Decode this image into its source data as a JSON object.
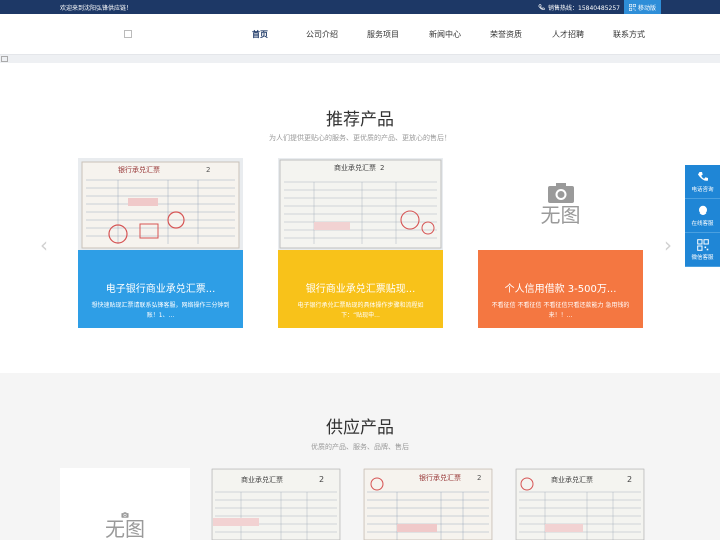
{
  "topbar": {
    "welcome": "欢迎来到沈阳弘锋供应链！",
    "hotline_label": "销售热线：15840485257",
    "mobile_label": "移动版"
  },
  "nav": {
    "items": [
      {
        "label": "首页",
        "active": true
      },
      {
        "label": "公司介绍"
      },
      {
        "label": "服务项目"
      },
      {
        "label": "新闻中心"
      },
      {
        "label": "荣誉资质"
      },
      {
        "label": "人才招聘"
      },
      {
        "label": "联系方式"
      }
    ]
  },
  "recommended": {
    "title": "推荐产品",
    "subtitle": "为人们提供更贴心的服务、更优质的产品、更放心的售后！",
    "cards": [
      {
        "title": "电子银行商业承兑汇票...",
        "desc": "想快速贴现汇票请联系弘锋客服，网络操作三分钟到账！1、...",
        "cheque_header": "银行承兑汇票",
        "cheque_no": "2"
      },
      {
        "title": "银行商业承兑汇票贴现...",
        "desc": "电子银行承兑汇票贴现的具体操作步骤和流程如下：“贴现申...",
        "cheque_header": "商业承兑汇票",
        "cheque_no": "2"
      },
      {
        "title": "个人信用借款 3-500万...",
        "desc": "不看征信 不看征信 不看征信只看还款能力 急用钱的来！！...",
        "noimg_text": "无图"
      }
    ]
  },
  "supply": {
    "title": "供应产品",
    "subtitle": "优质的产品、服务、品牌、售后",
    "cards": [
      {
        "noimg_text": "无图"
      },
      {
        "cheque_header": "商业承兑汇票",
        "cheque_no": "2"
      },
      {
        "cheque_header": "银行承兑汇票",
        "cheque_no": "2"
      },
      {
        "cheque_header": "商业承兑汇票",
        "cheque_no": "2"
      }
    ]
  },
  "sidebar": {
    "items": [
      {
        "label": "电话咨询",
        "icon": "phone-icon"
      },
      {
        "label": "在线客服",
        "icon": "chat-icon"
      },
      {
        "label": "微信客服",
        "icon": "qrcode-icon"
      }
    ]
  },
  "colors": {
    "topbar": "#1d3866",
    "blue": "#2e9ee6",
    "yellow": "#f8c21a",
    "orange": "#f47741",
    "sidebar": "#1f86d6"
  }
}
